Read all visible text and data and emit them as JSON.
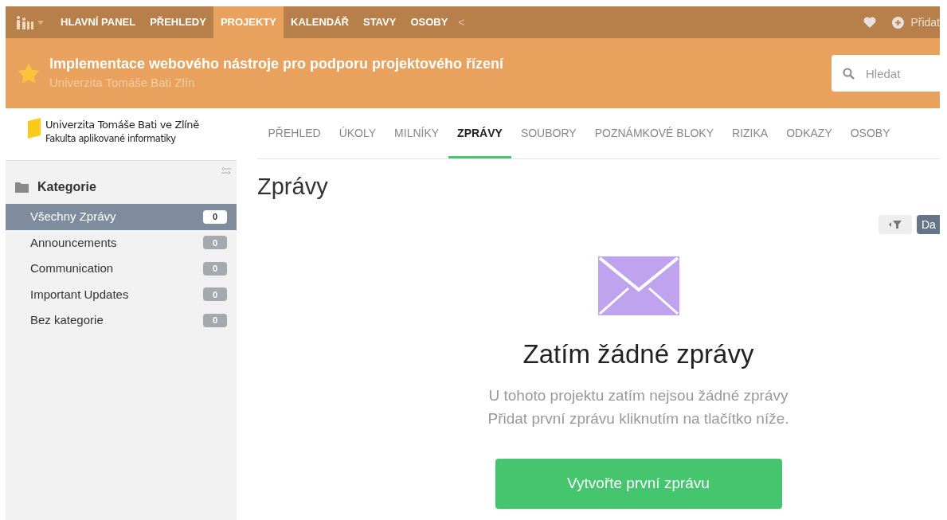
{
  "top_nav": {
    "items": [
      {
        "label": "HLAVNÍ PANEL",
        "selected": false
      },
      {
        "label": "PŘEHLEDY",
        "selected": false
      },
      {
        "label": "PROJEKTY",
        "selected": true
      },
      {
        "label": "KALENDÁŘ",
        "selected": false
      },
      {
        "label": "STAVY",
        "selected": false
      },
      {
        "label": "OSOBY",
        "selected": false
      }
    ],
    "collapse": "<",
    "add_label": "Přidat"
  },
  "project_header": {
    "title": "Implementace webového nástroje pro podporu projektového řízení",
    "subtitle": "Univerzita Tomáše Bati Zlín",
    "search": {
      "placeholder": "Hledat"
    }
  },
  "sidebar": {
    "logo": {
      "line_1": "Univerzita Tomáše Bati ve Zlíně",
      "line_2": "Fakulta aplikované informatiky"
    },
    "heading": "Kategorie",
    "items": [
      {
        "label": "Všechny Zprávy",
        "count": "0",
        "selected": true
      },
      {
        "label": "Announcements",
        "count": "0",
        "selected": false
      },
      {
        "label": "Communication",
        "count": "0",
        "selected": false
      },
      {
        "label": "Important Updates",
        "count": "0",
        "selected": false
      },
      {
        "label": "Bez kategorie",
        "count": "0",
        "selected": false
      }
    ]
  },
  "tabs": [
    {
      "label": "PŘEHLED",
      "selected": false
    },
    {
      "label": "ÚKOLY",
      "selected": false
    },
    {
      "label": "MILNÍKY",
      "selected": false
    },
    {
      "label": "ZPRÁVY",
      "selected": true
    },
    {
      "label": "SOUBORY",
      "selected": false
    },
    {
      "label": "POZNÁMKOVÉ BLOKY",
      "selected": false
    },
    {
      "label": "RIZIKA",
      "selected": false
    },
    {
      "label": "ODKAZY",
      "selected": false
    },
    {
      "label": "OSOBY",
      "selected": false
    }
  ],
  "page_title": "Zprávy",
  "toolbar": {
    "sort_button": "Da"
  },
  "empty_state": {
    "title": "Zatím žádné zprávy",
    "lines": [
      "U tohoto projektu zatím nejsou žádné zprávy",
      "Přidat první zprávu kliknutím na tlačítko níže."
    ],
    "button": "Vytvořte první zprávu"
  }
}
